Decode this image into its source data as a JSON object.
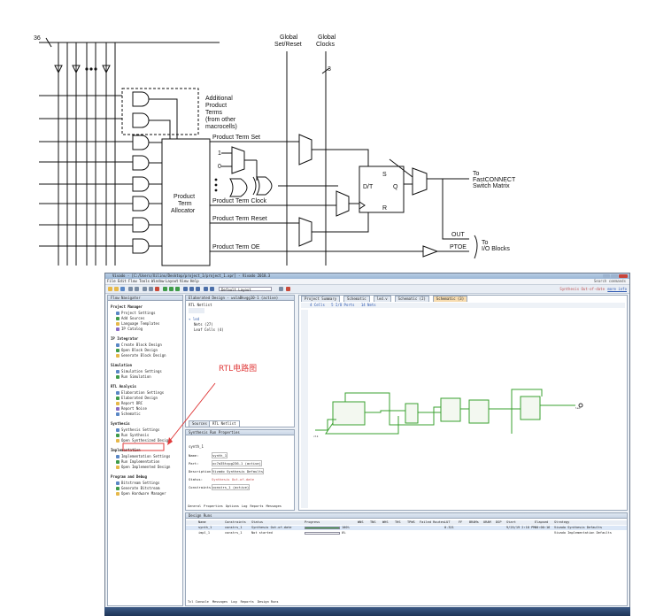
{
  "schematic": {
    "bus_count": "36",
    "clock_count": "3",
    "global_set_reset": [
      "Global",
      "Set/Reset"
    ],
    "global_clocks": [
      "Global",
      "Clocks"
    ],
    "additional_terms": [
      "Additional",
      "Product",
      "Terms",
      "(from other",
      "macrocells)"
    ],
    "allocator": [
      "Product",
      "Term",
      "Allocator"
    ],
    "signals": {
      "pt_set": "Product Term Set",
      "pt_clock": "Product Term Clock",
      "pt_reset": "Product Term Reset",
      "pt_oe": "Product Term OE",
      "one": "1",
      "zero": "0"
    },
    "ff": {
      "s": "S",
      "dt": "D/T",
      "q": "Q",
      "r": "R"
    },
    "outputs": {
      "fast": [
        "To",
        "FastCONNECT",
        "Switch Matrix"
      ],
      "out": "OUT",
      "ptoe": "PTOE",
      "io": [
        "To",
        "I/O Blocks"
      ]
    }
  },
  "app": {
    "title": "Vivado - [C:/Users/Xilinx/Desktop/project_1/project_1.xpr] - Vivado 2018.3",
    "menus": [
      "File",
      "Edit",
      "Flow",
      "Tools",
      "Window",
      "Layout",
      "View",
      "Help"
    ],
    "layout_select": "Default Layout",
    "search_placeholder": "Search commands",
    "status_right": "Synthesis Out-of-date",
    "status_link": "more info"
  },
  "flow_navigator": {
    "header": "Flow Navigator",
    "sections": [
      {
        "title": "Project Manager",
        "items": [
          "Project Settings",
          "Add Sources",
          "Language Templates",
          "IP Catalog"
        ]
      },
      {
        "title": "IP Integrator",
        "items": [
          "Create Block Design",
          "Open Block Design",
          "Generate Block Design"
        ]
      },
      {
        "title": "Simulation",
        "items": [
          "Simulation Settings",
          "Run Simulation"
        ]
      },
      {
        "title": "RTL Analysis",
        "items": [
          "Elaboration Settings",
          "Elaborated Design",
          "Report DRC",
          "Report Noise",
          "Schematic"
        ]
      },
      {
        "title": "Synthesis",
        "items": [
          "Synthesis Settings",
          "Run Synthesis",
          "Open Synthesized Design"
        ]
      },
      {
        "title": "Implementation",
        "items": [
          "Implementation Settings",
          "Run Implementation",
          "Open Implemented Design"
        ]
      },
      {
        "title": "Program and Debug",
        "items": [
          "Bitstream Settings",
          "Generate Bitstream",
          "Open Hardware Manager"
        ]
      }
    ]
  },
  "annotation": {
    "label": "RTL电路图"
  },
  "elaborated": {
    "header": "Elaborated Design - wulaBkvgg10-1 (active)",
    "netlist_header": "RTL Netlist",
    "tree": [
      "Nets (27)",
      "Leaf Cells (4)"
    ],
    "tabs": [
      "Sources",
      "RTL Netlist"
    ]
  },
  "properties": {
    "header": "Synthesis Run Properties",
    "run": "synth_1",
    "fields": [
      {
        "label": "Name:",
        "value": "synth_1"
      },
      {
        "label": "Part:",
        "value": "xc7a35tcpg236-1 (active)"
      },
      {
        "label": "Description:",
        "value": "Vivado Synthesis Defaults"
      },
      {
        "label": "Status:",
        "value": "Synthesis Out-of-date"
      },
      {
        "label": "Constraints:",
        "value": "constrs_1 (active)"
      }
    ],
    "tabs": [
      "General",
      "Properties",
      "Options",
      "Log",
      "Reports",
      "Messages"
    ]
  },
  "schematic_view": {
    "tabs": [
      "Project Summary",
      "Schematic",
      "led.v",
      "Schematic (2)",
      "Schematic (3)"
    ],
    "info": [
      "4 Cells",
      "5 I/O Ports",
      "14 Nets"
    ]
  },
  "design_runs": {
    "header": "Design Runs",
    "columns": [
      "Name",
      "Constraints",
      "Status",
      "Progress",
      "WNS",
      "TNS",
      "WHS",
      "THS",
      "TPWS",
      "Failed Routes",
      "LUT",
      "FF",
      "BRAMs",
      "URAM",
      "DSP",
      "Start",
      "Elapsed",
      "Strategy"
    ],
    "rows": [
      {
        "name": "synth_1",
        "constraints": "constrs_1",
        "status": "Synthesis Out-of-date",
        "progress": "100%",
        "lut": "0.321",
        "strategy": "Vivado Synthesis Defaults"
      },
      {
        "name": "impl_1",
        "constraints": "constrs_1",
        "status": "Not started",
        "progress": "0%",
        "lut": "",
        "strategy": "Vivado Implementation Defaults"
      }
    ],
    "time": "9/25/19 2:18 PM",
    "elapsed": "00:00:16"
  },
  "bottom_tabs": [
    "Tcl Console",
    "Messages",
    "Log",
    "Reports",
    "Design Runs"
  ]
}
